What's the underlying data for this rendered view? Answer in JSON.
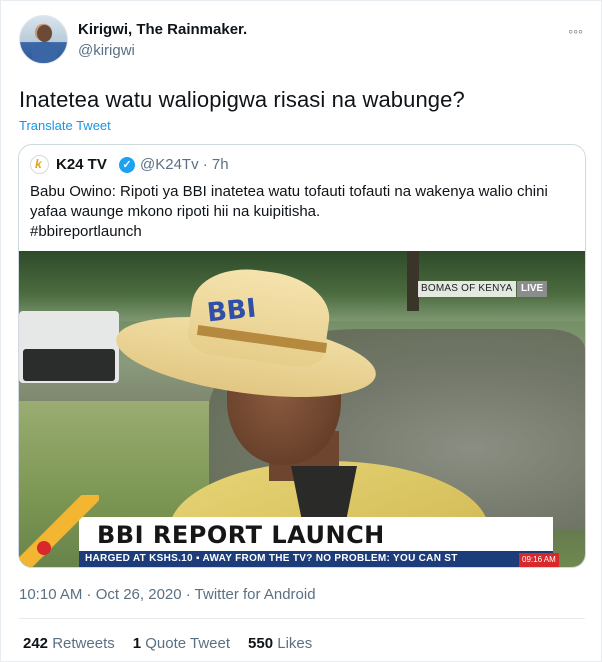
{
  "author": {
    "name": "Kirigwi, The Rainmaker.",
    "handle": "@kirigwi"
  },
  "tweet": {
    "text": "Inatetea watu waliopigwa risasi na wabunge?",
    "translate_label": "Translate Tweet"
  },
  "quoted": {
    "logo_text": "k",
    "name": "K24 TV",
    "handle_time": "@K24Tv · 7h",
    "text_line1": "Babu Owino: Ripoti ya BBI inatetea watu tofauti tofauti na wakenya walio chini",
    "text_line2": "yafaa waunge mkono ripoti hii na kuipitisha.",
    "hashtag": "#bbireportlaunch",
    "media": {
      "hat_logo": "BBI",
      "location": "BOMAS OF KENYA",
      "live": "LIVE",
      "headline": "BBI REPORT LAUNCH",
      "ticker": "HARGED AT KSHS.10  ▪ AWAY FROM THE TV? NO PROBLEM: YOU CAN ST",
      "clock": "09:16 AM"
    }
  },
  "meta": "10:10 AM · Oct 26, 2020 · Twitter for Android",
  "stats": {
    "retweets_count": "242",
    "retweets_label": "Retweets",
    "quotes_count": "1",
    "quotes_label": "Quote Tweet",
    "likes_count": "550",
    "likes_label": "Likes"
  },
  "colors": {
    "link": "#1b95e0",
    "verified": "#1da1f2",
    "secondary_text": "#5b7083"
  }
}
